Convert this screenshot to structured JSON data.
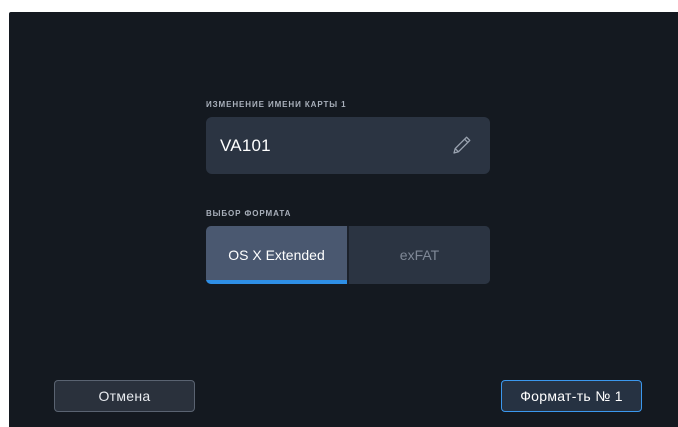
{
  "name_section": {
    "label": "ИЗМЕНЕНИЕ ИМЕНИ КАРТЫ 1",
    "value": "VA101",
    "icon": "pencil-icon"
  },
  "format_section": {
    "label": "ВЫБОР ФОРМАТА",
    "options": [
      {
        "label": "OS X Extended",
        "selected": true
      },
      {
        "label": "exFAT",
        "selected": false
      }
    ]
  },
  "buttons": {
    "cancel_label": "Отмена",
    "format_label": "Формат-ть № 1"
  },
  "colors": {
    "background": "#141920",
    "field": "#2b3442",
    "selected_segment": "#4a5870",
    "accent": "#2e8fe6"
  }
}
